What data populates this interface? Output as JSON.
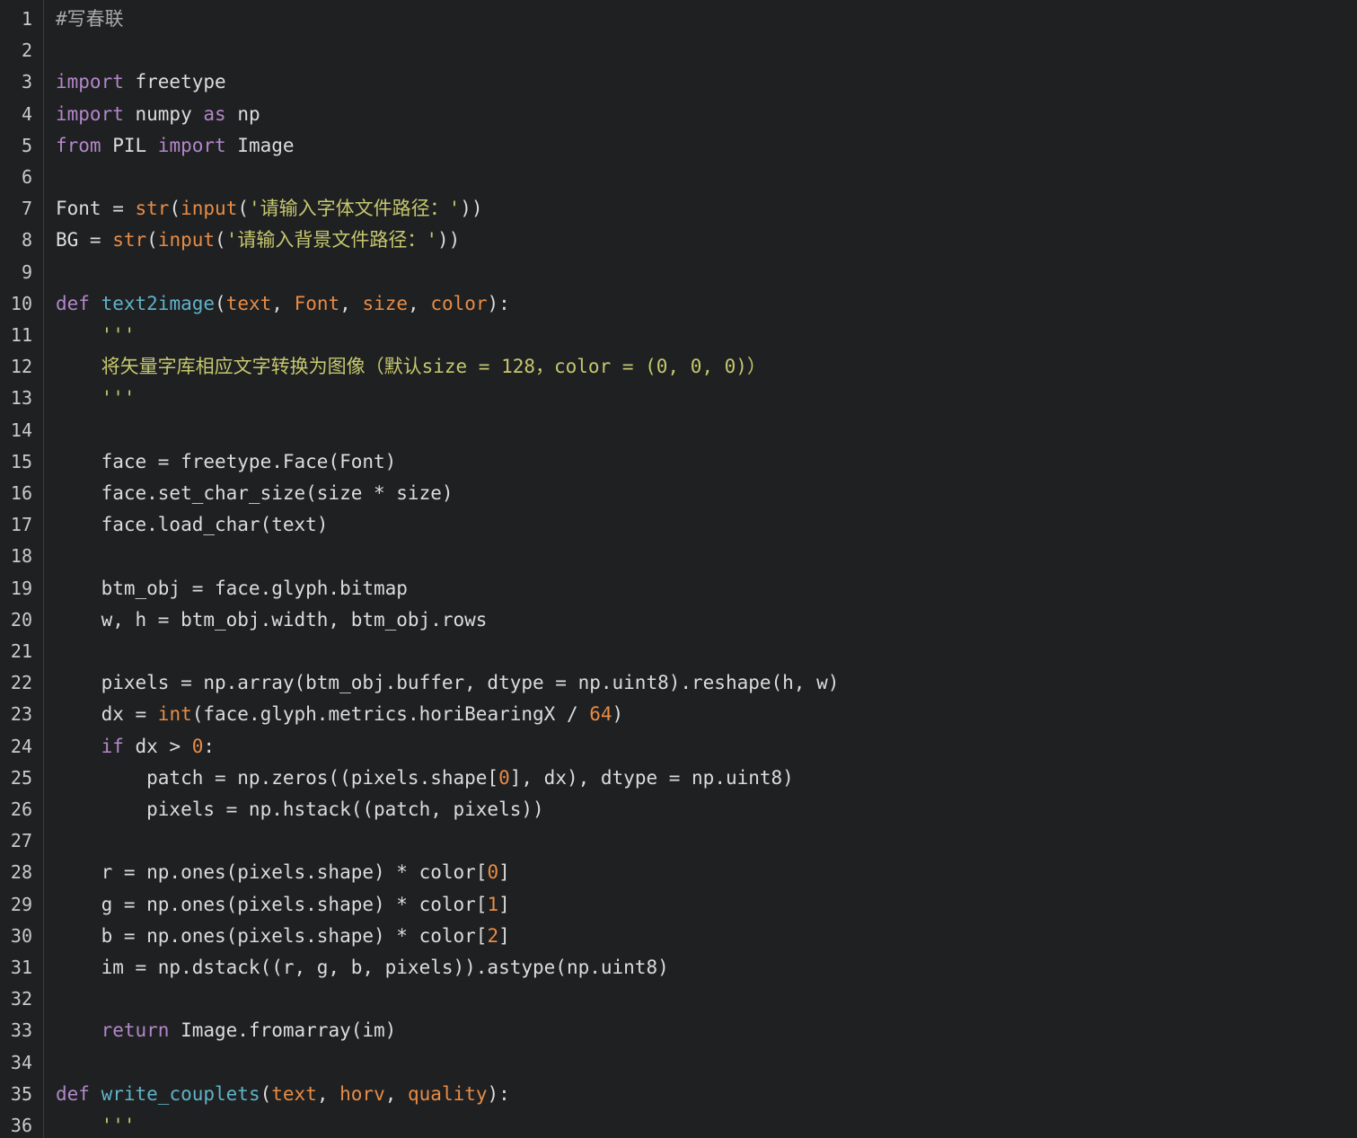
{
  "editor": {
    "lines": [
      {
        "n": "1",
        "tokens": [
          {
            "t": "#写春联",
            "c": "comment"
          }
        ]
      },
      {
        "n": "2",
        "tokens": []
      },
      {
        "n": "3",
        "tokens": [
          {
            "t": "import",
            "c": "kw"
          },
          {
            "t": " freetype",
            "c": "plain"
          }
        ]
      },
      {
        "n": "4",
        "tokens": [
          {
            "t": "import",
            "c": "kw"
          },
          {
            "t": " numpy ",
            "c": "plain"
          },
          {
            "t": "as",
            "c": "kw"
          },
          {
            "t": " np",
            "c": "plain"
          }
        ]
      },
      {
        "n": "5",
        "tokens": [
          {
            "t": "from",
            "c": "kw"
          },
          {
            "t": " PIL ",
            "c": "plain"
          },
          {
            "t": "import",
            "c": "kw"
          },
          {
            "t": " Image",
            "c": "plain"
          }
        ]
      },
      {
        "n": "6",
        "tokens": []
      },
      {
        "n": "7",
        "tokens": [
          {
            "t": "Font = ",
            "c": "plain"
          },
          {
            "t": "str",
            "c": "builtin"
          },
          {
            "t": "(",
            "c": "plain"
          },
          {
            "t": "input",
            "c": "builtin"
          },
          {
            "t": "(",
            "c": "plain"
          },
          {
            "t": "'请输入字体文件路径：'",
            "c": "str"
          },
          {
            "t": "))",
            "c": "plain"
          }
        ]
      },
      {
        "n": "8",
        "tokens": [
          {
            "t": "BG = ",
            "c": "plain"
          },
          {
            "t": "str",
            "c": "builtin"
          },
          {
            "t": "(",
            "c": "plain"
          },
          {
            "t": "input",
            "c": "builtin"
          },
          {
            "t": "(",
            "c": "plain"
          },
          {
            "t": "'请输入背景文件路径：'",
            "c": "str"
          },
          {
            "t": "))",
            "c": "plain"
          }
        ]
      },
      {
        "n": "9",
        "tokens": []
      },
      {
        "n": "10",
        "tokens": [
          {
            "t": "def",
            "c": "def"
          },
          {
            "t": " ",
            "c": "plain"
          },
          {
            "t": "text2image",
            "c": "fn"
          },
          {
            "t": "(",
            "c": "plain"
          },
          {
            "t": "text",
            "c": "param"
          },
          {
            "t": ", ",
            "c": "plain"
          },
          {
            "t": "Font",
            "c": "param"
          },
          {
            "t": ", ",
            "c": "plain"
          },
          {
            "t": "size",
            "c": "param"
          },
          {
            "t": ", ",
            "c": "plain"
          },
          {
            "t": "color",
            "c": "param"
          },
          {
            "t": "):",
            "c": "plain"
          }
        ]
      },
      {
        "n": "11",
        "tokens": [
          {
            "t": "    '''",
            "c": "doc"
          }
        ]
      },
      {
        "n": "12",
        "tokens": [
          {
            "t": "    将矢量字库相应文字转换为图像（默认size = 128，color = (0, 0, 0)）",
            "c": "doc"
          }
        ]
      },
      {
        "n": "13",
        "tokens": [
          {
            "t": "    '''",
            "c": "doc"
          }
        ]
      },
      {
        "n": "14",
        "tokens": []
      },
      {
        "n": "15",
        "tokens": [
          {
            "t": "    face = freetype.Face(Font)",
            "c": "plain"
          }
        ]
      },
      {
        "n": "16",
        "tokens": [
          {
            "t": "    face.set_char_size(size * size)",
            "c": "plain"
          }
        ]
      },
      {
        "n": "17",
        "tokens": [
          {
            "t": "    face.load_char(text)",
            "c": "plain"
          }
        ]
      },
      {
        "n": "18",
        "tokens": []
      },
      {
        "n": "19",
        "tokens": [
          {
            "t": "    btm_obj = face.glyph.bitmap",
            "c": "plain"
          }
        ]
      },
      {
        "n": "20",
        "tokens": [
          {
            "t": "    w, h = btm_obj.width, btm_obj.rows",
            "c": "plain"
          }
        ]
      },
      {
        "n": "21",
        "tokens": []
      },
      {
        "n": "22",
        "tokens": [
          {
            "t": "    pixels = np.array(btm_obj.buffer, dtype = np.uint8).reshape(h, w)",
            "c": "plain"
          }
        ]
      },
      {
        "n": "23",
        "tokens": [
          {
            "t": "    dx = ",
            "c": "plain"
          },
          {
            "t": "int",
            "c": "builtin"
          },
          {
            "t": "(face.glyph.metrics.horiBearingX / ",
            "c": "plain"
          },
          {
            "t": "64",
            "c": "num"
          },
          {
            "t": ")",
            "c": "plain"
          }
        ]
      },
      {
        "n": "24",
        "tokens": [
          {
            "t": "    ",
            "c": "plain"
          },
          {
            "t": "if",
            "c": "kw"
          },
          {
            "t": " dx > ",
            "c": "plain"
          },
          {
            "t": "0",
            "c": "num"
          },
          {
            "t": ":",
            "c": "plain"
          }
        ]
      },
      {
        "n": "25",
        "tokens": [
          {
            "t": "        patch = np.zeros((pixels.shape[",
            "c": "plain"
          },
          {
            "t": "0",
            "c": "num"
          },
          {
            "t": "], dx), dtype = np.uint8)",
            "c": "plain"
          }
        ]
      },
      {
        "n": "26",
        "tokens": [
          {
            "t": "        pixels = np.hstack((patch, pixels))",
            "c": "plain"
          }
        ]
      },
      {
        "n": "27",
        "tokens": []
      },
      {
        "n": "28",
        "tokens": [
          {
            "t": "    r = np.ones(pixels.shape) * color[",
            "c": "plain"
          },
          {
            "t": "0",
            "c": "num"
          },
          {
            "t": "]",
            "c": "plain"
          }
        ]
      },
      {
        "n": "29",
        "tokens": [
          {
            "t": "    g = np.ones(pixels.shape) * color[",
            "c": "plain"
          },
          {
            "t": "1",
            "c": "num"
          },
          {
            "t": "]",
            "c": "plain"
          }
        ]
      },
      {
        "n": "30",
        "tokens": [
          {
            "t": "    b = np.ones(pixels.shape) * color[",
            "c": "plain"
          },
          {
            "t": "2",
            "c": "num"
          },
          {
            "t": "]",
            "c": "plain"
          }
        ]
      },
      {
        "n": "31",
        "tokens": [
          {
            "t": "    im = np.dstack((r, g, b, pixels)).astype(np.uint8)",
            "c": "plain"
          }
        ]
      },
      {
        "n": "32",
        "tokens": []
      },
      {
        "n": "33",
        "tokens": [
          {
            "t": "    ",
            "c": "plain"
          },
          {
            "t": "return",
            "c": "kw"
          },
          {
            "t": " Image.fromarray(im)",
            "c": "plain"
          }
        ]
      },
      {
        "n": "34",
        "tokens": []
      },
      {
        "n": "35",
        "tokens": [
          {
            "t": "def",
            "c": "def"
          },
          {
            "t": " ",
            "c": "plain"
          },
          {
            "t": "write_couplets",
            "c": "fn"
          },
          {
            "t": "(",
            "c": "plain"
          },
          {
            "t": "text",
            "c": "param"
          },
          {
            "t": ", ",
            "c": "plain"
          },
          {
            "t": "horv",
            "c": "param"
          },
          {
            "t": ", ",
            "c": "plain"
          },
          {
            "t": "quality",
            "c": "param"
          },
          {
            "t": "):",
            "c": "plain"
          }
        ]
      },
      {
        "n": "36",
        "tokens": [
          {
            "t": "    '''",
            "c": "doc"
          }
        ]
      }
    ]
  }
}
